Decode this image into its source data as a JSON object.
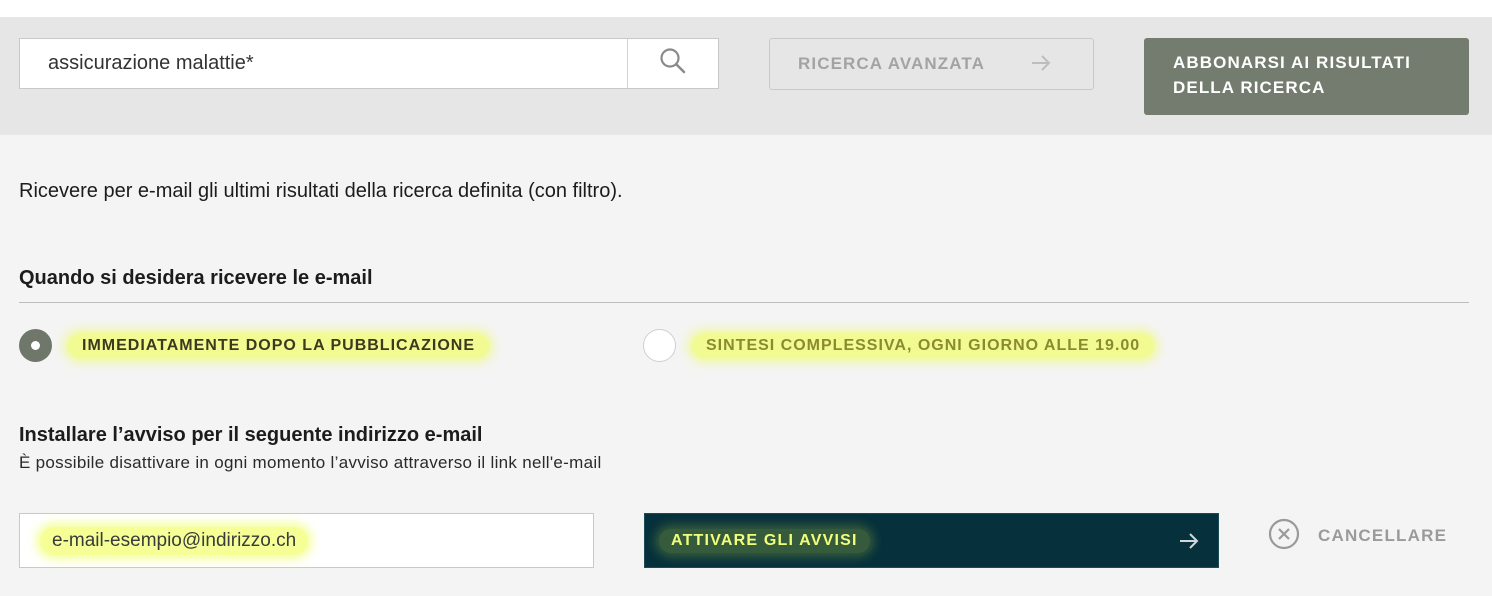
{
  "search": {
    "query": "assicurazione malattie*",
    "search_icon": "search-icon"
  },
  "advanced_search": {
    "label": "RICERCA AVANZATA",
    "icon": "arrow-right-icon"
  },
  "subscribe": {
    "label": "ABBONARSI AI RISULTATI\nDELLA RICERCA"
  },
  "intro_text": "Ricevere per e-mail gli ultimi risultati della ricerca definita (con filtro).",
  "frequency": {
    "title": "Quando si desidera ricevere le e-mail",
    "options": [
      {
        "label": "IMMEDIATAMENTE DOPO LA PUBBLICAZIONE",
        "selected": true
      },
      {
        "label": "SINTESI COMPLESSIVA, OGNI GIORNO ALLE 19.00",
        "selected": false
      }
    ]
  },
  "email_section": {
    "title": "Installare l’avviso per il seguente indirizzo e-mail",
    "note": "È possibile disattivare in ogni momento l’avviso attraverso il link nell'e-mail",
    "email_value": "e-mail-esempio@indirizzo.ch"
  },
  "actions": {
    "activate_label": "ATTIVARE GLI AVVISI",
    "cancel_label": "CANCELLARE"
  },
  "colors": {
    "subscribe_bg": "#737c6e",
    "activate_bg": "#06313c",
    "highlight": "#eeff50"
  }
}
